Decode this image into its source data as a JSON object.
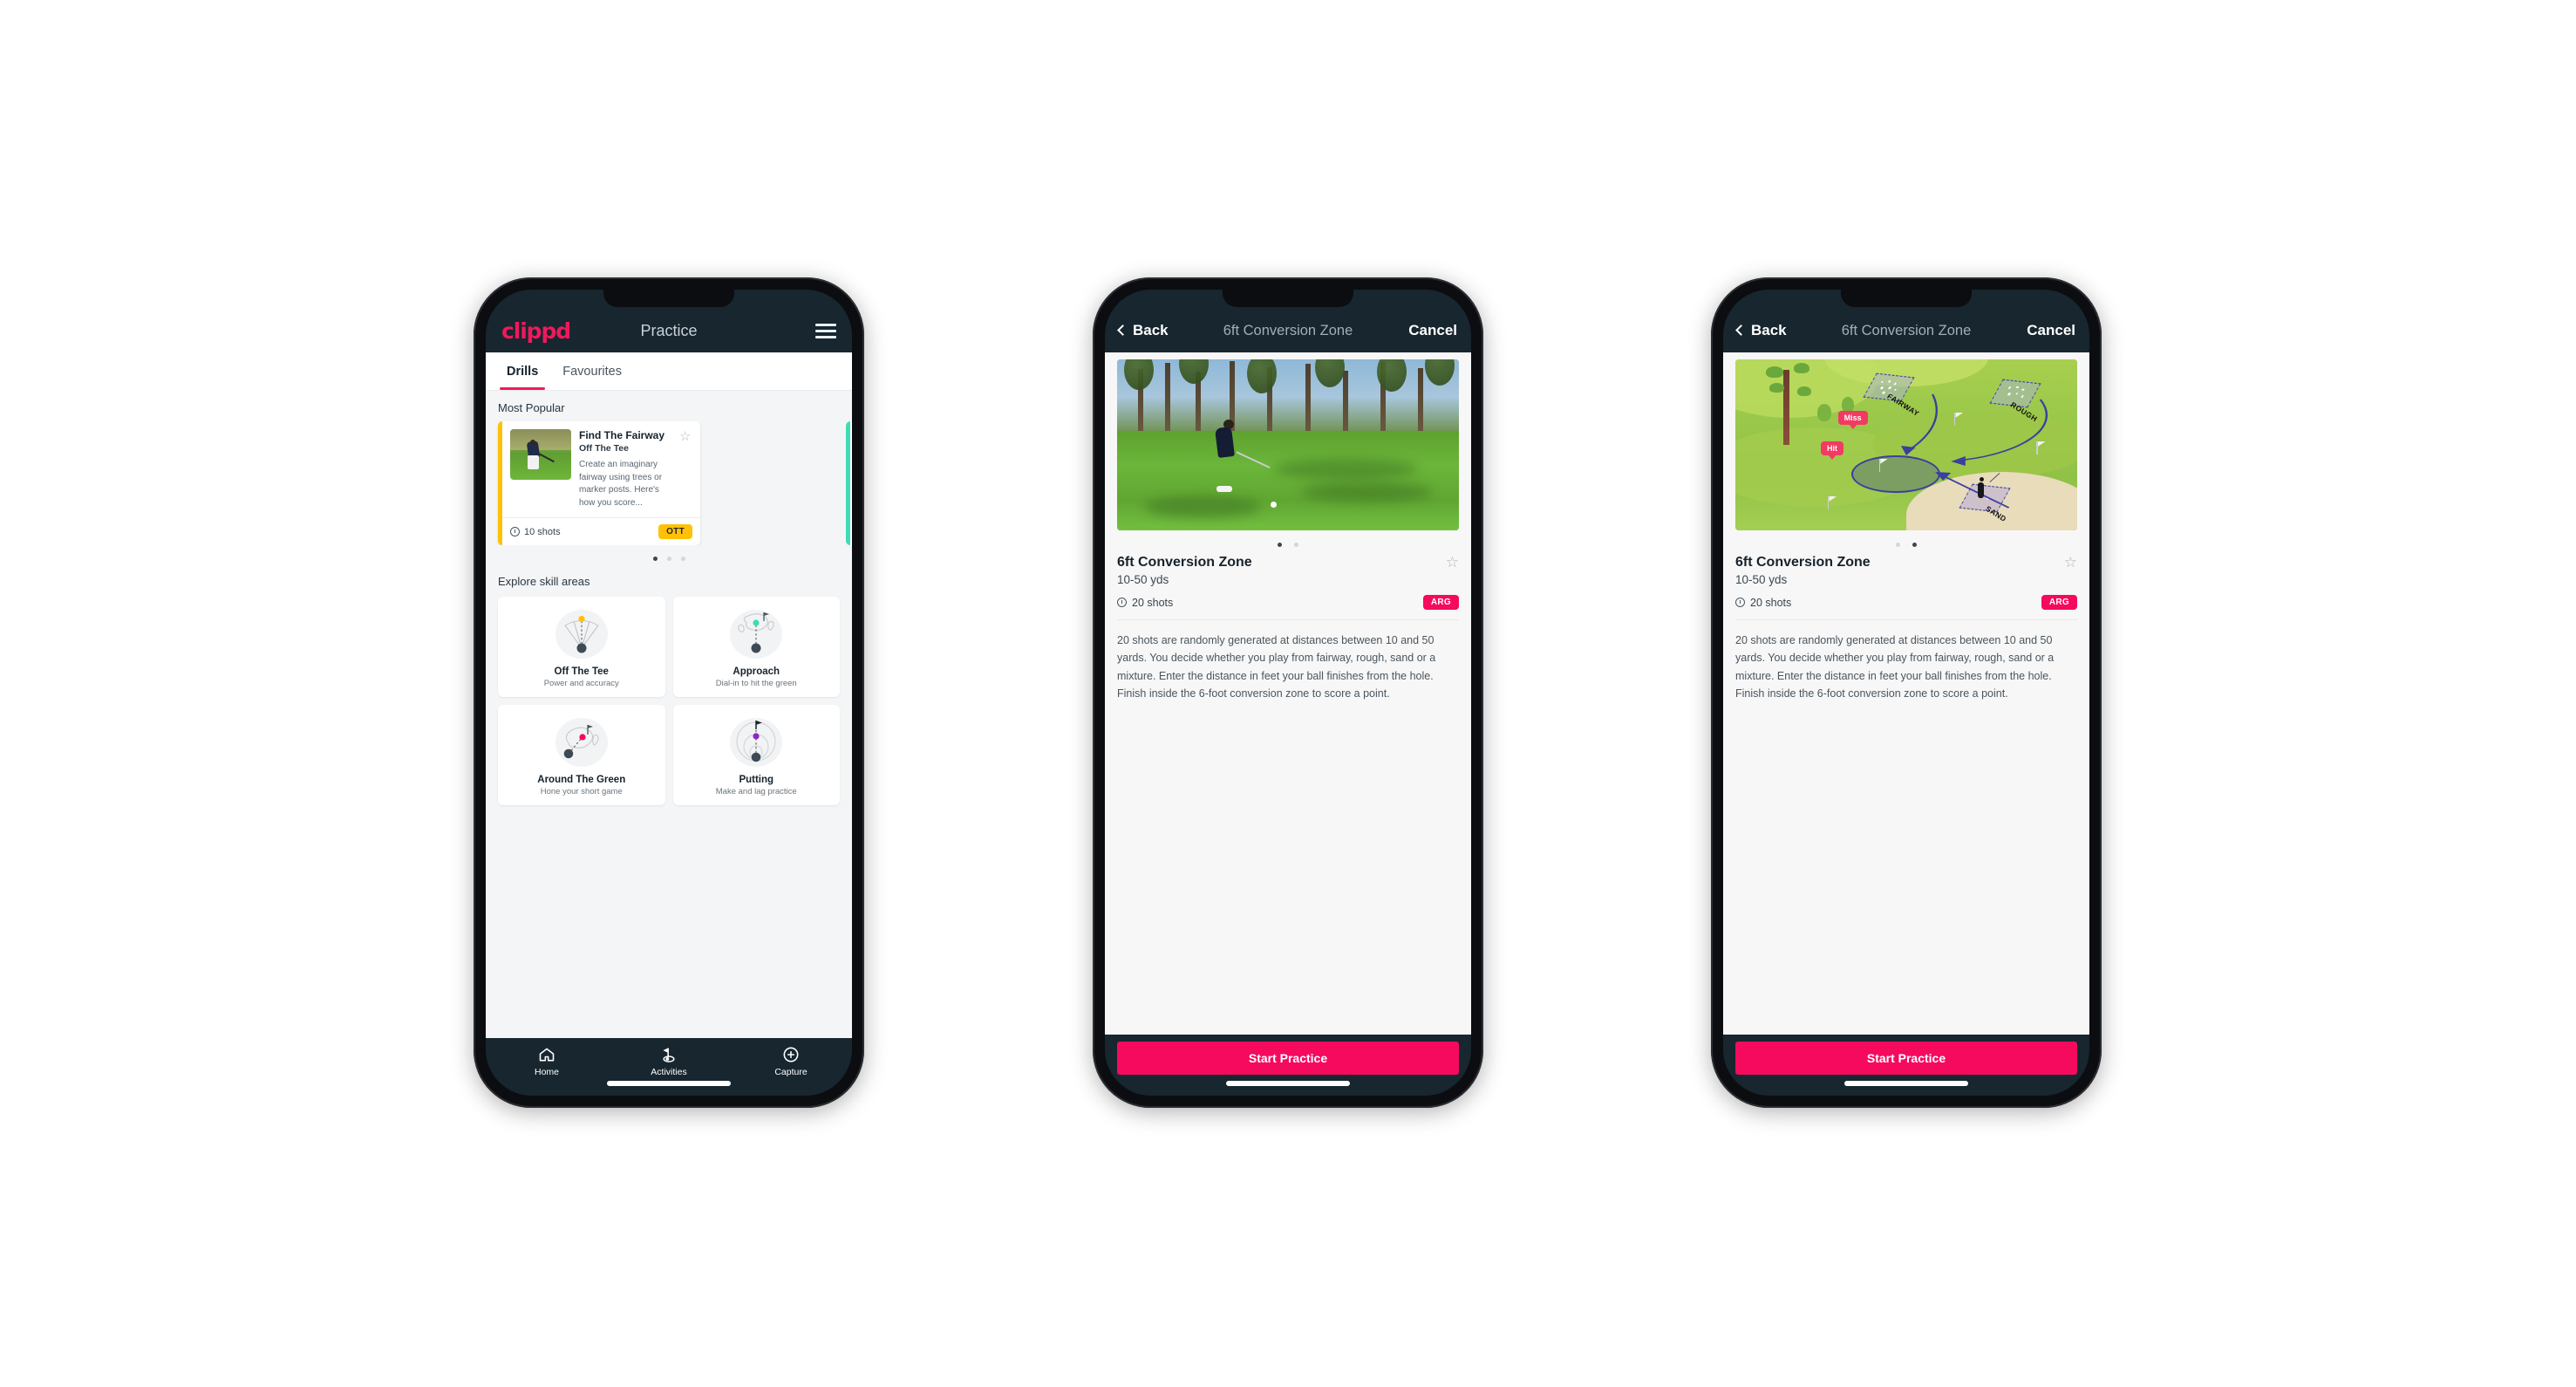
{
  "app": {
    "brand": "clippd",
    "brand_color": "#ed1a5b",
    "header_bg": "#17262f",
    "accent_pink": "#f50a5d",
    "accent_amber": "#ffc107",
    "accent_teal": "#3edcb4"
  },
  "phone1": {
    "appbar": {
      "logo": "clippd",
      "title": "Practice",
      "menu_icon": "hamburger-icon"
    },
    "tabs": [
      {
        "label": "Drills",
        "active": true
      },
      {
        "label": "Favourites",
        "active": false
      }
    ],
    "most_popular": {
      "section_label": "Most Popular",
      "card": {
        "title": "Find The Fairway",
        "subtitle": "Off The Tee",
        "description": "Create an imaginary fairway using trees or marker posts. Here's how you score...",
        "shots": "10 shots",
        "badge": "OTT",
        "badge_color": "#ffc107",
        "accent_bar_color": "#ffc107",
        "favourite_icon": "star-outline-icon",
        "shots_icon": "clock-icon",
        "thumbnail_alt": "golfer-teeing-off-photo"
      },
      "dots": {
        "count": 3,
        "active_index": 0
      }
    },
    "skill_areas": {
      "section_label": "Explore skill areas",
      "items": [
        {
          "name": "Off The Tee",
          "desc": "Power and accuracy",
          "icon": "tee-fan-icon",
          "dot_color": "#ffc107"
        },
        {
          "name": "Approach",
          "desc": "Dial-in to hit the green",
          "icon": "approach-green-icon",
          "dot_color": "#3edcb4"
        },
        {
          "name": "Around The Green",
          "desc": "Hone your short game",
          "icon": "around-green-icon",
          "dot_color": "#f50a5d"
        },
        {
          "name": "Putting",
          "desc": "Make and lag practice",
          "icon": "putting-rings-icon",
          "dot_color": "#8e24c9"
        }
      ]
    },
    "tabbar": [
      {
        "label": "Home",
        "icon": "home-icon",
        "active": false
      },
      {
        "label": "Activities",
        "icon": "golf-flag-icon",
        "active": true
      },
      {
        "label": "Capture",
        "icon": "plus-circle-icon",
        "active": false
      }
    ]
  },
  "phone2": {
    "navbar": {
      "back": "Back",
      "title": "6ft Conversion Zone",
      "cancel": "Cancel",
      "back_icon": "chevron-left-icon"
    },
    "hero": {
      "type": "photo",
      "alt": "golfer-chipping-onto-green-photo"
    },
    "dots": {
      "count": 2,
      "active_index": 0
    },
    "detail": {
      "title": "6ft Conversion Zone",
      "yardage": "10-50 yds",
      "shots": "20 shots",
      "badge": "ARG",
      "badge_color": "#f50a5d",
      "favourite_icon": "star-outline-icon",
      "shots_icon": "clock-icon",
      "description": "20 shots are randomly generated at distances between 10 and 50 yards. You decide whether you play from fairway, rough, sand or a mixture. Enter the distance in feet your ball finishes from the hole. Finish inside the 6-foot conversion zone to score a point."
    },
    "cta": {
      "label": "Start Practice"
    }
  },
  "phone3": {
    "navbar": {
      "back": "Back",
      "title": "6ft Conversion Zone",
      "cancel": "Cancel",
      "back_icon": "chevron-left-icon"
    },
    "hero": {
      "type": "illustration",
      "alt": "golf-hole-diagram-illustration",
      "labels": [
        "FAIRWAY",
        "ROUGH",
        "SAND"
      ],
      "callouts": [
        "Miss",
        "Hit"
      ]
    },
    "dots": {
      "count": 2,
      "active_index": 1
    },
    "detail": {
      "title": "6ft Conversion Zone",
      "yardage": "10-50 yds",
      "shots": "20 shots",
      "badge": "ARG",
      "badge_color": "#f50a5d",
      "favourite_icon": "star-outline-icon",
      "shots_icon": "clock-icon",
      "description": "20 shots are randomly generated at distances between 10 and 50 yards. You decide whether you play from fairway, rough, sand or a mixture. Enter the distance in feet your ball finishes from the hole. Finish inside the 6-foot conversion zone to score a point."
    },
    "cta": {
      "label": "Start Practice"
    }
  }
}
